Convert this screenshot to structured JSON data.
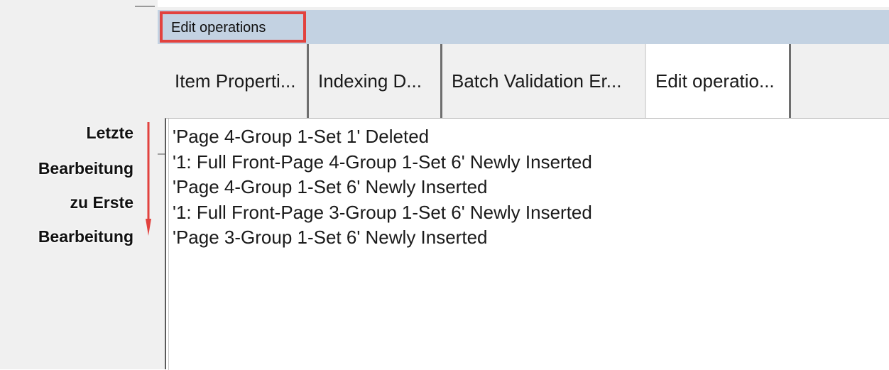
{
  "panel": {
    "title": "Edit operations"
  },
  "tabs": [
    {
      "label": "Item Properti...",
      "active": false
    },
    {
      "label": "Indexing D...",
      "active": false
    },
    {
      "label": "Batch Validation Er...",
      "active": false
    },
    {
      "label": "Edit operatio...",
      "active": true
    }
  ],
  "operations": [
    "'Page 4-Group 1-Set 1' Deleted",
    "'1: Full Front-Page 4-Group 1-Set 6' Newly Inserted",
    "'Page 4-Group 1-Set 6' Newly Inserted",
    "'1: Full Front-Page 3-Group 1-Set 6' Newly Inserted",
    "'Page 3-Group 1-Set 6' Newly Inserted"
  ],
  "annotation": {
    "lines": [
      "Letzte",
      "Bearbeitung",
      "zu Erste",
      "Bearbeitung"
    ],
    "arrow_color": "#e2423e",
    "highlight_color": "#e2423e"
  }
}
